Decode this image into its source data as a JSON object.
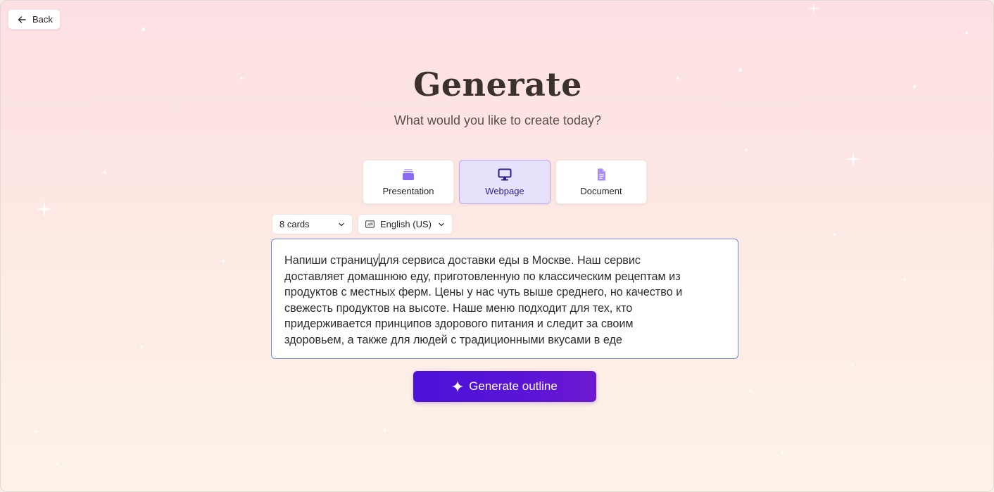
{
  "header": {
    "back_label": "Back"
  },
  "hero": {
    "title": "Generate",
    "subtitle": "What would you like to create today?"
  },
  "content_types": [
    {
      "label": "Presentation",
      "icon": "presentation-icon",
      "selected": false
    },
    {
      "label": "Webpage",
      "icon": "monitor-icon",
      "selected": true
    },
    {
      "label": "Document",
      "icon": "document-icon",
      "selected": false
    }
  ],
  "options": {
    "cards": "8 cards",
    "language": "English (US)",
    "language_icon": "language-icon"
  },
  "prompt": {
    "lines": [
      "Напиши страницу",
      "для сервиса доставки еды в Москве. Наш сервис",
      "доставляет домашнюю еду, приготовленную по классическим рецептам из",
      "продуктов с местных ферм. Цены у нас чуть выше среднего, но качество и",
      "свежесть продуктов на высоте. Наше меню подходит для тех, кто",
      "придерживается принципов здорового питания и следит за своим",
      "здоровьем, а также для людей с традиционными вкусами в еде"
    ]
  },
  "actions": {
    "generate_label": "Generate outline"
  },
  "colors": {
    "accent": "#4a12d8",
    "selected_bg": "#e7e2fb",
    "icon_purple": "#8b6cf0",
    "icon_indigo": "#2c1f8a"
  }
}
